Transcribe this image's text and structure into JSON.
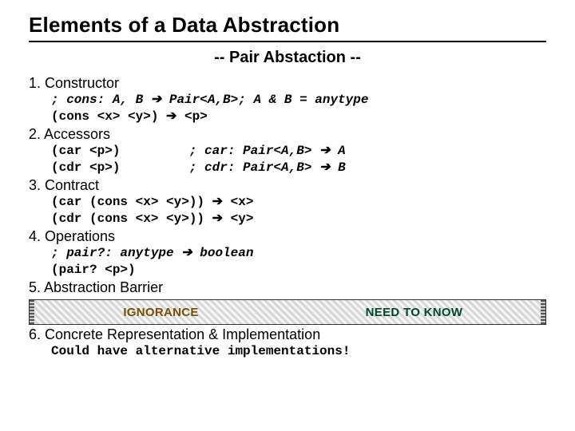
{
  "title": "Elements of a Data Abstraction",
  "subtitle": "-- Pair Abstaction --",
  "sections": {
    "s1": {
      "head": "1. Constructor"
    },
    "s2": {
      "head": "2. Accessors"
    },
    "s3": {
      "head": "3. Contract"
    },
    "s4": {
      "head": "4. Operations"
    },
    "s5": {
      "head": "5. Abstraction Barrier"
    },
    "s6": {
      "head": "6. Concrete Representation & Implementation"
    }
  },
  "code": {
    "cons_sig_pre": "; cons: A, B ",
    "cons_sig_post": " Pair<A,B>; A & B = anytype",
    "cons_call_pre": "(cons <x> <y>) ",
    "cons_call_post": " <p>",
    "car_call": "(car <p>)         ",
    "car_sig_pre": "; car: Pair<A,B> ",
    "car_sig_post": " A",
    "cdr_call": "(cdr <p>)         ",
    "cdr_sig_pre": "; cdr: Pair<A,B> ",
    "cdr_sig_post": " B",
    "contract1_pre": "(car (cons <x> <y>)) ",
    "contract1_post": " <x>",
    "contract2_pre": "(cdr (cons <x> <y>)) ",
    "contract2_post": " <y>",
    "pairq_sig_pre": "; pair?: anytype ",
    "pairq_sig_post": " boolean",
    "pairq_call": "(pair? <p>)",
    "impl_note": "Could have alternative implementations!"
  },
  "arrow": "➔",
  "barrier": {
    "left": "IGNORANCE",
    "right": "NEED TO KNOW"
  }
}
